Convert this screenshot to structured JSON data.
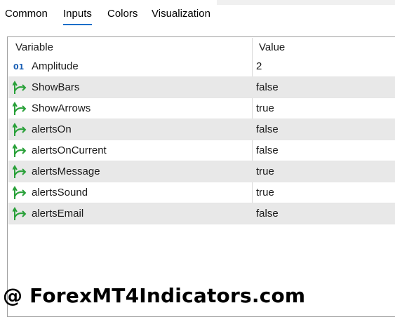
{
  "tabs": [
    {
      "label": "Common",
      "active": false
    },
    {
      "label": "Inputs",
      "active": true
    },
    {
      "label": "Colors",
      "active": false
    },
    {
      "label": "Visualization",
      "active": false
    }
  ],
  "table": {
    "headers": {
      "variable": "Variable",
      "value": "Value"
    },
    "rows": [
      {
        "icon": "integer-icon",
        "name": "Amplitude",
        "value": "2"
      },
      {
        "icon": "bool-arrow-icon",
        "name": "ShowBars",
        "value": "false"
      },
      {
        "icon": "bool-arrow-icon",
        "name": "ShowArrows",
        "value": "true"
      },
      {
        "icon": "bool-arrow-icon",
        "name": "alertsOn",
        "value": "false"
      },
      {
        "icon": "bool-arrow-icon",
        "name": "alertsOnCurrent",
        "value": "false"
      },
      {
        "icon": "bool-arrow-icon",
        "name": "alertsMessage",
        "value": "true"
      },
      {
        "icon": "bool-arrow-icon",
        "name": "alertsSound",
        "value": "true"
      },
      {
        "icon": "bool-arrow-icon",
        "name": "alertsEmail",
        "value": "false"
      }
    ]
  },
  "watermark": "@ ForexMT4Indicators.com",
  "colors": {
    "active_tab_underline": "#1a6fc9",
    "bool_icon": "#2aa13a",
    "integer_icon": "#1a5fb4",
    "shaded_row": "#e8e8e8"
  }
}
